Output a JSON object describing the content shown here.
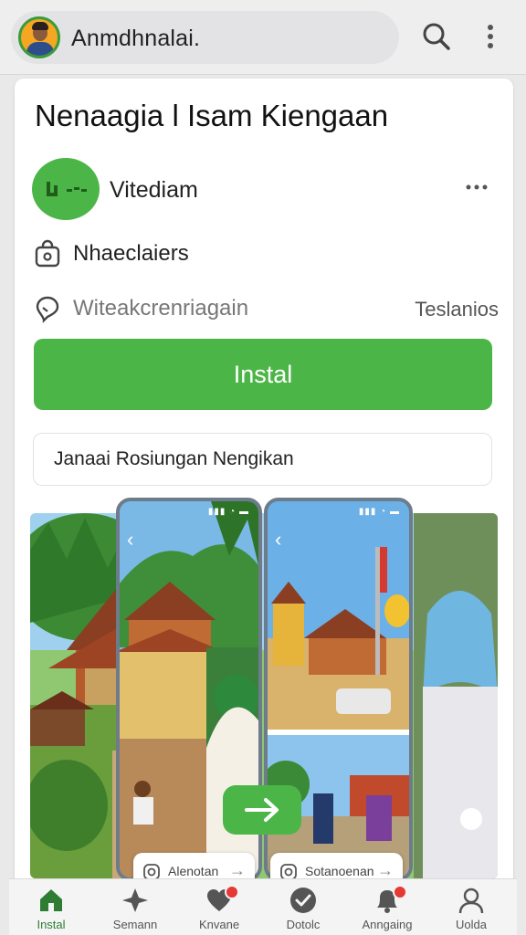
{
  "topbar": {
    "title": "Anmdhnalai.",
    "icons": [
      "avatar",
      "search-icon",
      "more-vert-icon"
    ]
  },
  "app": {
    "title": "Nenaagia l Isam Kiengaan",
    "developer": "Vitediam",
    "category": "Nhaeclaiers",
    "subtitle": "Witeakcrenriagain",
    "subtitle_right": "Teslanios",
    "install_label": "Instal",
    "description": "Janaai Rosiungan Nengikan"
  },
  "gallery": {
    "chips": [
      {
        "label": "Alenotan"
      },
      {
        "label": "Sotanoenan"
      }
    ]
  },
  "nav": {
    "items": [
      {
        "label": "Instal",
        "icon": "home-icon",
        "active": true
      },
      {
        "label": "Semann",
        "icon": "explore-icon"
      },
      {
        "label": "Knvane",
        "icon": "heart-icon",
        "badge": true
      },
      {
        "label": "Dotolc",
        "icon": "check-icon"
      },
      {
        "label": "Anngaing",
        "icon": "notifications-icon",
        "badge": true
      },
      {
        "label": "Uolda",
        "icon": "profile-icon"
      }
    ]
  },
  "colors": {
    "accent": "#4cb548",
    "badge": "#e53935",
    "background": "#e9e9ea"
  }
}
